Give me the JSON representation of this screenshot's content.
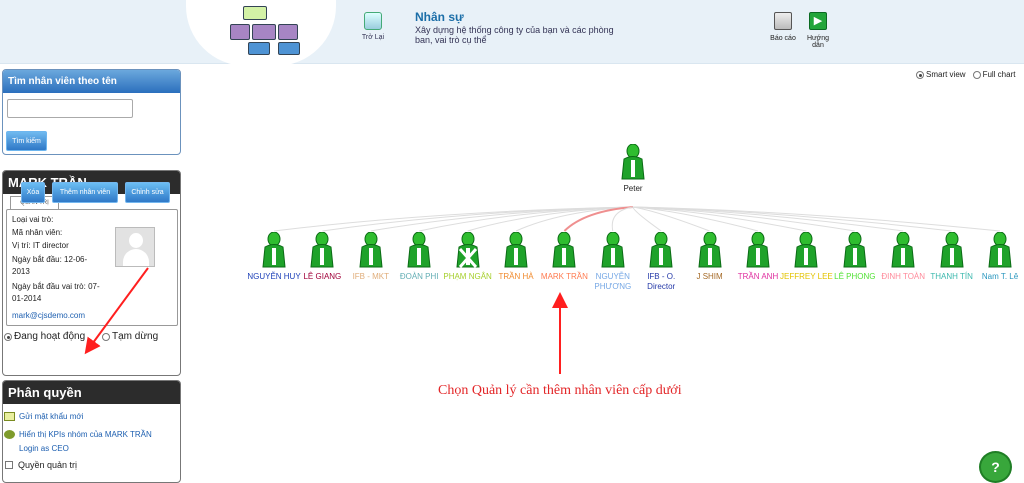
{
  "header": {
    "back_label": "Trở Lại",
    "title": "Nhân sự",
    "subtitle": "Xây dựng hệ thống công ty của bạn và các phòng ban, vai trò cụ thể",
    "report_label": "Báo cáo",
    "guide_label": "Hướng dẫn"
  },
  "search": {
    "title": "Tìm nhân viên theo tên",
    "input_value": "",
    "button_label": "Tìm kiếm"
  },
  "profile": {
    "name": "MARK TRẦN",
    "tab_label": "QUẢN TRỊ",
    "role_type": "Loại vai trò:",
    "employee_code": "Mã nhân viên:",
    "position_label": "Vị trí:",
    "position_value": "IT director",
    "start_date_label": "Ngày bắt đầu:",
    "start_date_value": "12-06-2013",
    "role_start_label": "Ngày bắt đầu vai trò:",
    "role_start_value": "07-01-2014",
    "email": "mark@cjsdemo.com",
    "status_active": "Đang hoạt động",
    "status_paused": "Tạm dừng",
    "buttons": [
      "Xóa",
      "Thêm nhân viên",
      "Chỉnh sửa"
    ]
  },
  "permissions": {
    "title": "Phân quyền",
    "links": [
      "Gửi mật khẩu mới",
      "Hiển thị KPIs nhóm của MARK TRẦN",
      "Login as CEO"
    ],
    "admin_label": "Quyền quản trị"
  },
  "view_options": [
    "Smart view",
    "Full chart"
  ],
  "chart": {
    "root": "Peter",
    "employees": [
      {
        "name": "NGUYỄN HUY",
        "color": "#1d40b8"
      },
      {
        "name": "LÊ GIANG",
        "color": "#a00039"
      },
      {
        "name": "IFB - MKT",
        "color": "#e0ad7a"
      },
      {
        "name": "ĐOÀN PHI",
        "color": "#63aeb4"
      },
      {
        "name": "PHẠM NGÂN",
        "color": "#a6cf2c"
      },
      {
        "name": "TRẦN HÀ",
        "color": "#f08a2d"
      },
      {
        "name": "MARK TRẦN",
        "color": "#ff7a4f"
      },
      {
        "name": "NGUYỄN PHƯƠNG",
        "color": "#76a8e5"
      },
      {
        "name": "IFB - O. Director",
        "color": "#263aa8"
      },
      {
        "name": "J SHIM",
        "color": "#a56a27"
      },
      {
        "name": "TRẦN ANH",
        "color": "#df2f9f"
      },
      {
        "name": "JEFFREY LEE",
        "color": "#e3c300"
      },
      {
        "name": "LÊ PHONG",
        "color": "#53e236"
      },
      {
        "name": "ĐINH TOÀN",
        "color": "#ff8a9a"
      },
      {
        "name": "THANH TÍN",
        "color": "#3bb8ad"
      },
      {
        "name": "Nam T. Lê",
        "color": "#2a97bf"
      }
    ]
  },
  "instruction": "Chọn Quản lý cần thêm nhân viên cấp dưới"
}
